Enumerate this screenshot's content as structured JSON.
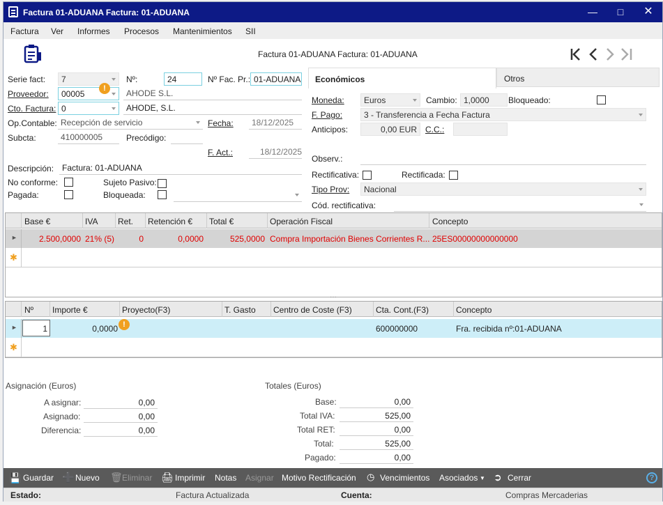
{
  "window": {
    "title": "Factura 01-ADUANA  Factura: 01-ADUANA"
  },
  "menu": [
    "Factura",
    "Ver",
    "Informes",
    "Procesos",
    "Mantenimientos",
    "SII"
  ],
  "header": {
    "subtitle": "Factura 01-ADUANA  Factura: 01-ADUANA"
  },
  "form": {
    "serie_label": "Serie fact:",
    "serie_value": "7",
    "num_label": "Nº:",
    "num_value": "24",
    "fac_pr_label": "Nº Fac. Pr.:",
    "fac_pr_value": "01-ADUANA",
    "proveedor_label": "Proveedor:",
    "proveedor_value": "00005",
    "proveedor_name": "AHODE S.L.",
    "cto_label": "Cto. Factura:",
    "cto_value": "0",
    "cto_name": "AHODE, S.L.",
    "opcontable_label": "Op.Contable:",
    "opcontable_value": "Recepción de servicio",
    "fecha_label": "Fecha:",
    "fecha_value": "18/12/2025",
    "subcta_label": "Subcta:",
    "subcta_value": "410000005",
    "precodigo_label": "Precódigo:",
    "fact_label": "F. Act.:",
    "fact_value": "18/12/2025",
    "descripcion_label": "Descripción:",
    "descripcion_value": "Factura: 01-ADUANA",
    "noconforme_label": "No conforme:",
    "sujeto_label": "Sujeto Pasivo:",
    "pagada_label": "Pagada:",
    "bloqueada_label": "Bloqueada:"
  },
  "tabs": {
    "economicos": "Económicos",
    "otros": "Otros"
  },
  "eco": {
    "moneda_label": "Moneda:",
    "moneda_value": "Euros",
    "cambio_label": "Cambio:",
    "cambio_value": "1,0000",
    "bloqueado_label": "Bloqueado:",
    "fpago_label": "F. Pago:",
    "fpago_value": "3 - Transferencia a Fecha Factura",
    "anticipos_label": "Anticipos:",
    "anticipos_value": "0,00 EUR",
    "cc_label": "C.C.:",
    "observ_label": "Observ.:",
    "rectificativa_label": "Rectificativa:",
    "rectificada_label": "Rectificada:",
    "tipoprov_label": "Tipo Prov:",
    "tipoprov_value": "Nacional",
    "codrect_label": "Cód. rectificativa:"
  },
  "grid1": {
    "headers": [
      "Base €",
      "IVA",
      "Ret.",
      "Retención €",
      "Total €",
      "Operación Fiscal",
      "Concepto"
    ],
    "row": [
      "2.500,0000",
      "21% (5)",
      "0",
      "0,0000",
      "525,0000",
      "Compra Importación Bienes Corrientes R...",
      "25ES00000000000000"
    ]
  },
  "grid2": {
    "headers": [
      "Nº",
      "Importe €",
      "Proyecto(F3)",
      "T. Gasto",
      "Centro de Coste (F3)",
      "Cta. Cont.(F3)",
      "Concepto"
    ],
    "row": [
      "1",
      "0,0000",
      "",
      "",
      "",
      "600000000",
      "Fra. recibida nº:01-ADUANA"
    ]
  },
  "asignacion": {
    "title": "Asignación (Euros)",
    "a_asignar_label": "A asignar:",
    "a_asignar": "0,00",
    "asignado_label": "Asignado:",
    "asignado": "0,00",
    "diferencia_label": "Diferencia:",
    "diferencia": "0,00"
  },
  "totales": {
    "title": "Totales (Euros)",
    "base_label": "Base:",
    "base": "0,00",
    "iva_label": "Total IVA:",
    "iva": "525,00",
    "ret_label": "Total RET:",
    "ret": "0,00",
    "total_label": "Total:",
    "total": "525,00",
    "pagado_label": "Pagado:",
    "pagado": "0,00"
  },
  "toolbar": {
    "guardar": "Guardar",
    "nuevo": "Nuevo",
    "eliminar": "Eliminar",
    "imprimir": "Imprimir",
    "notas": "Notas",
    "asignar": "Asignar",
    "motivo": "Motivo Rectificación",
    "vencimientos": "Vencimientos",
    "asociados": "Asociados",
    "cerrar": "Cerrar"
  },
  "status": {
    "estado_label": "Estado:",
    "estado_value": "Factura Actualizada",
    "cuenta_label": "Cuenta:",
    "cuenta_value": "Compras Mercaderias"
  },
  "colors": {
    "titlebar": "#0d1a86",
    "accent_red": "#e00000",
    "selected_row": "#cdeef8"
  }
}
